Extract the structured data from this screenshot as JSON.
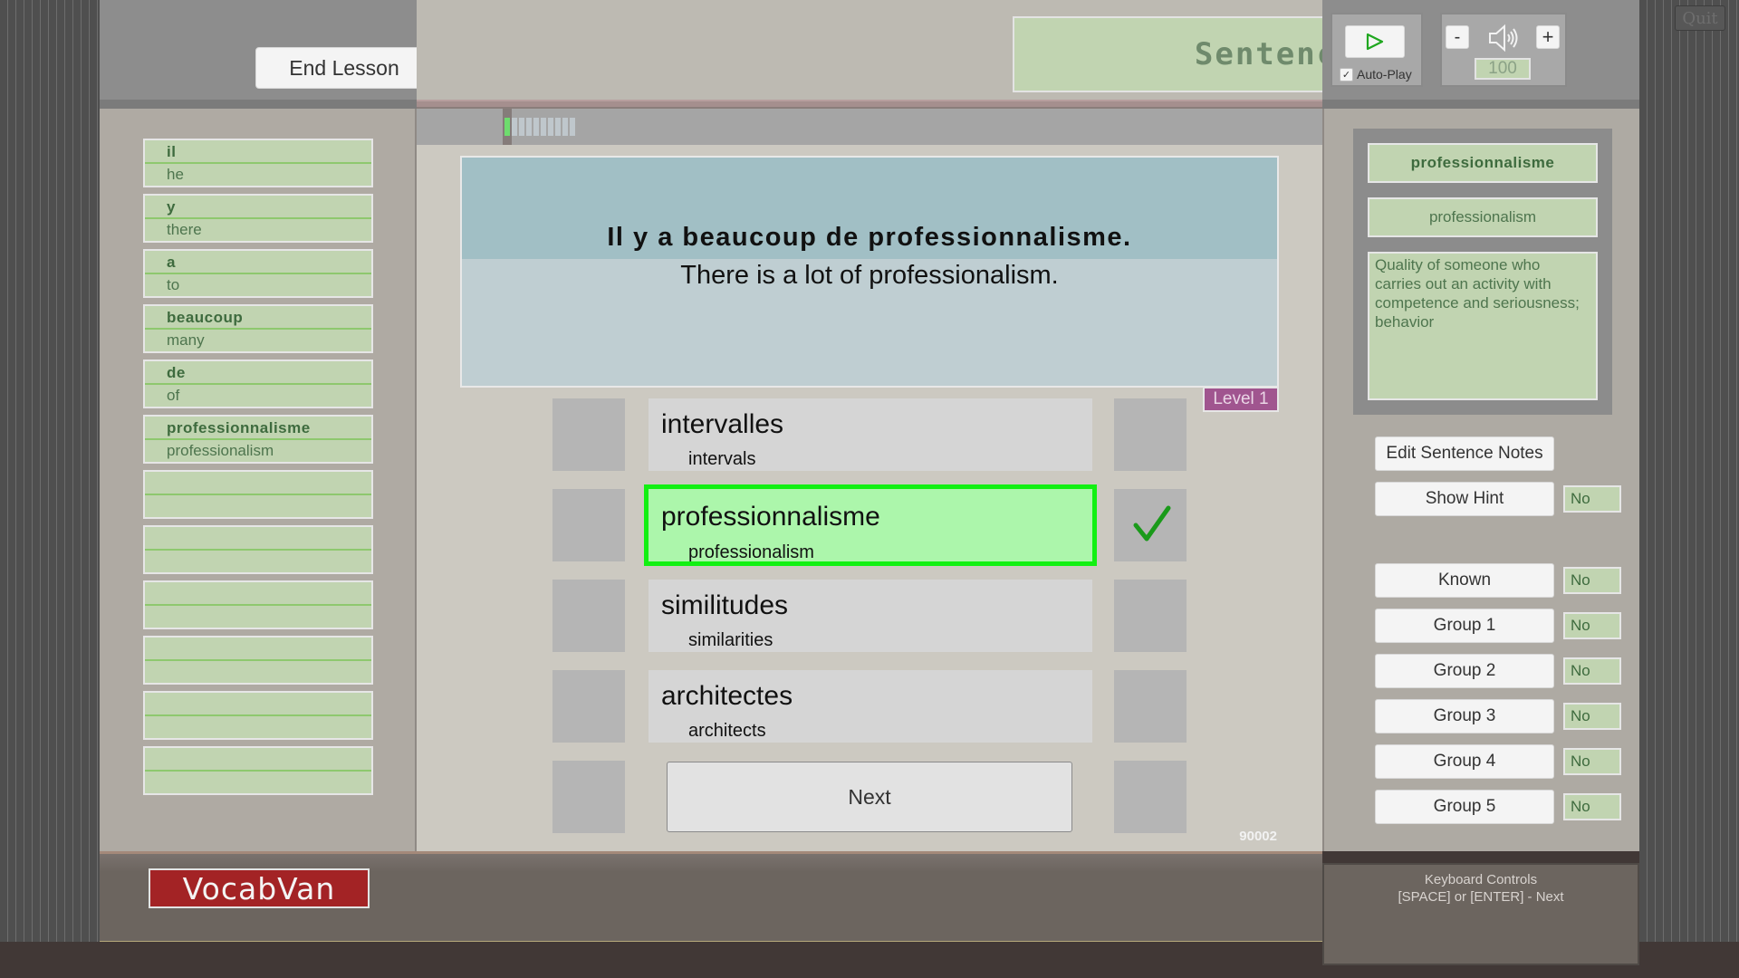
{
  "app": {
    "logo": "VocabVan",
    "quit_label": "Quit",
    "section_title": "Sentences"
  },
  "header": {
    "end_lesson_label": "End Lesson",
    "play_icon": "play-triangle-icon",
    "autoplay_label": "Auto-Play",
    "autoplay_checked": true,
    "volume_minus_label": "-",
    "volume_plus_label": "+",
    "volume_icon": "speaker-icon",
    "volume_value": "100"
  },
  "progress": {
    "total_cells": 10,
    "completed_cells": 1,
    "completed_color": "#6edc6e"
  },
  "word_list": [
    {
      "fr": "il",
      "en": "he"
    },
    {
      "fr": "y",
      "en": "there"
    },
    {
      "fr": "a",
      "en": "to"
    },
    {
      "fr": "beaucoup",
      "en": "many"
    },
    {
      "fr": "de",
      "en": "of"
    },
    {
      "fr": "professionnalisme",
      "en": "professionalism"
    },
    {
      "fr": "",
      "en": ""
    },
    {
      "fr": "",
      "en": ""
    },
    {
      "fr": "",
      "en": ""
    },
    {
      "fr": "",
      "en": ""
    },
    {
      "fr": "",
      "en": ""
    },
    {
      "fr": "",
      "en": ""
    }
  ],
  "sentence": {
    "french": "Il y a beaucoup de professionnalisme.",
    "english": "There is a lot of professionalism.",
    "level": "Level 1",
    "id": "90002"
  },
  "options": [
    {
      "fr": "intervalles",
      "en": "intervals",
      "state": "default"
    },
    {
      "fr": "professionnalisme",
      "en": "professionalism",
      "state": "correct"
    },
    {
      "fr": "similitudes",
      "en": "similarities",
      "state": "default"
    },
    {
      "fr": "architectes",
      "en": "architects",
      "state": "default"
    }
  ],
  "next_label": "Next",
  "correct_icon": "checkmark-icon",
  "correct_color": "#12f012",
  "detail": {
    "french": "professionnalisme",
    "english": "professionalism",
    "definition": "Quality of someone who carries out an activity with competence and seriousness; behavior"
  },
  "actions": {
    "edit_notes_label": "Edit Sentence Notes",
    "show_hint": {
      "label": "Show Hint",
      "value": "No"
    },
    "flags": [
      {
        "label": "Known",
        "value": "No"
      },
      {
        "label": "Group 1",
        "value": "No"
      },
      {
        "label": "Group 2",
        "value": "No"
      },
      {
        "label": "Group 3",
        "value": "No"
      },
      {
        "label": "Group 4",
        "value": "No"
      },
      {
        "label": "Group 5",
        "value": "No"
      }
    ]
  },
  "keyboard": {
    "title": "Keyboard Controls",
    "line": "[SPACE] or [ENTER] - Next"
  }
}
